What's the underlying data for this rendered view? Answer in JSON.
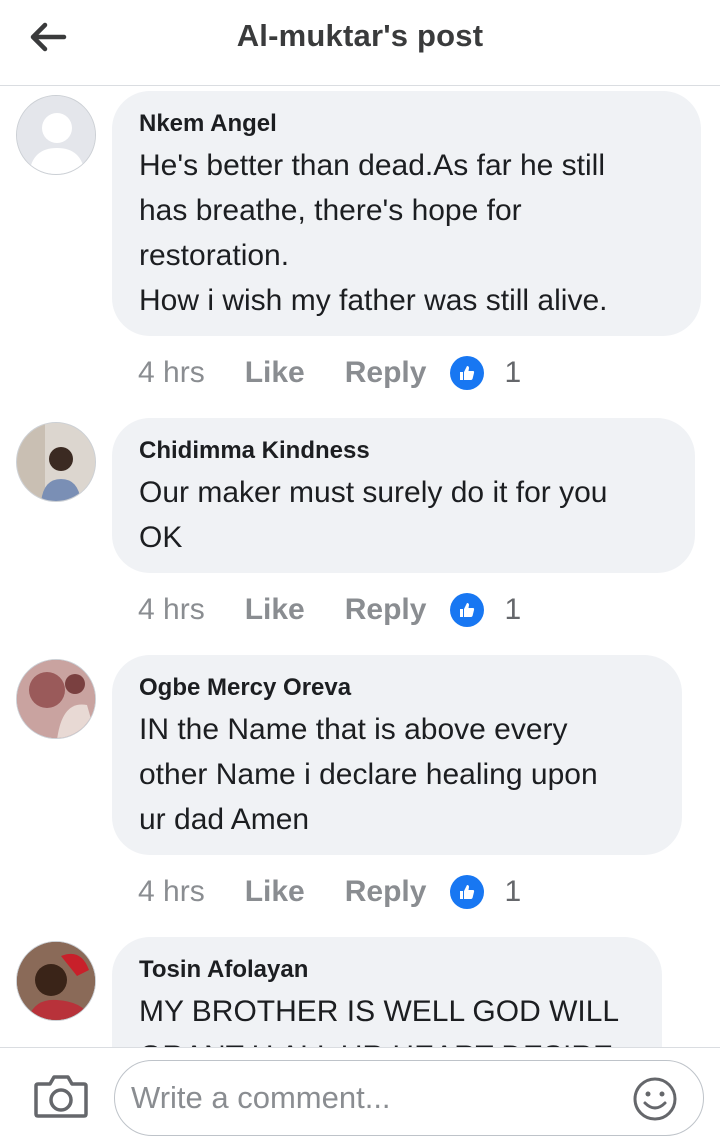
{
  "header": {
    "title": "Al-muktar's post",
    "back_icon": "arrow-left-icon"
  },
  "comments": [
    {
      "author": "Nkem Angel",
      "lines": [
        "He's better than dead.As far he still",
        "has breathe, there's hope for",
        "restoration.",
        "How i wish my father was still alive."
      ],
      "time": "4 hrs",
      "like_label": "Like",
      "reply_label": "Reply",
      "reactions": "1"
    },
    {
      "author": "Chidimma Kindness",
      "lines": [
        "Our maker must surely do it for you",
        "OK"
      ],
      "time": "4 hrs",
      "like_label": "Like",
      "reply_label": "Reply",
      "reactions": "1"
    },
    {
      "author": "Ogbe Mercy Oreva",
      "lines": [
        "IN the Name that is above every",
        "other Name i declare healing upon",
        "ur dad Amen"
      ],
      "time": "4 hrs",
      "like_label": "Like",
      "reply_label": "Reply",
      "reactions": "1"
    },
    {
      "author": "Tosin Afolayan",
      "lines": [
        "MY BROTHER IS WELL GOD WILL",
        "GRANT U ALL UR HEART DESIRE"
      ]
    }
  ],
  "composer": {
    "placeholder": "Write a comment...",
    "camera_icon": "camera-icon",
    "emoji_icon": "smiley-icon"
  },
  "colors": {
    "like_blue": "#1877f2",
    "bubble": "#f0f2f5",
    "muted": "#8a8d91"
  }
}
